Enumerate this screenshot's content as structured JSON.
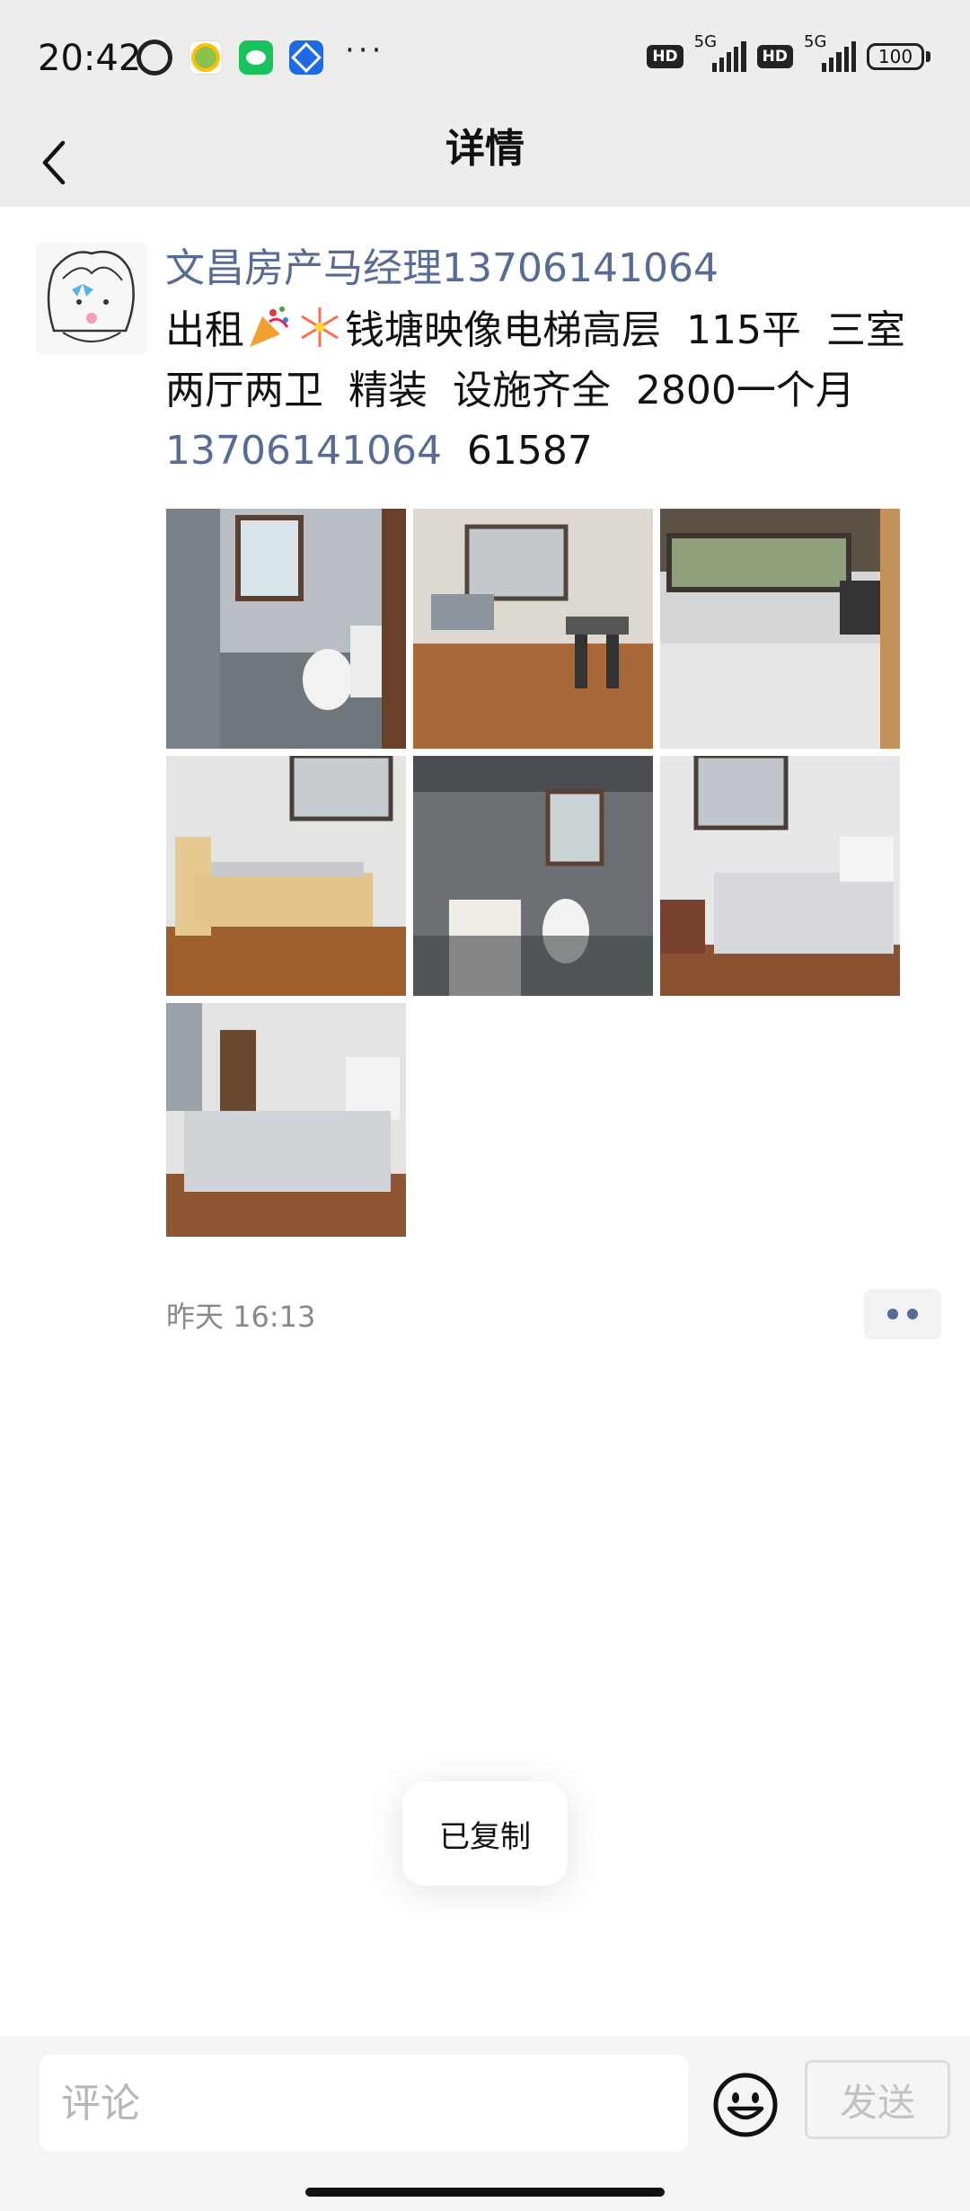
{
  "status_bar": {
    "time": "20:42",
    "more": "···",
    "hd1": "HD",
    "net1": "5G",
    "hd2": "HD",
    "net2": "5G",
    "battery": "100"
  },
  "header": {
    "title": "详情"
  },
  "post": {
    "author": "文昌房产马经理13706141064",
    "text_prefix": "出租",
    "text_main": "钱塘映像电梯高层  115平  三室两厅两卫  精装  设施齐全  2800一个月",
    "phone_link": "13706141064",
    "text_suffix": "  61587",
    "time": "昨天 16:13",
    "images": [
      "bathroom-photo",
      "living-room-photo",
      "balcony-photo",
      "bedroom-photo-1",
      "bathroom-photo-2",
      "bedroom-photo-2",
      "bedroom-photo-3"
    ]
  },
  "toast": {
    "text": "已复制"
  },
  "comment_bar": {
    "placeholder": "评论",
    "send_label": "发送"
  }
}
